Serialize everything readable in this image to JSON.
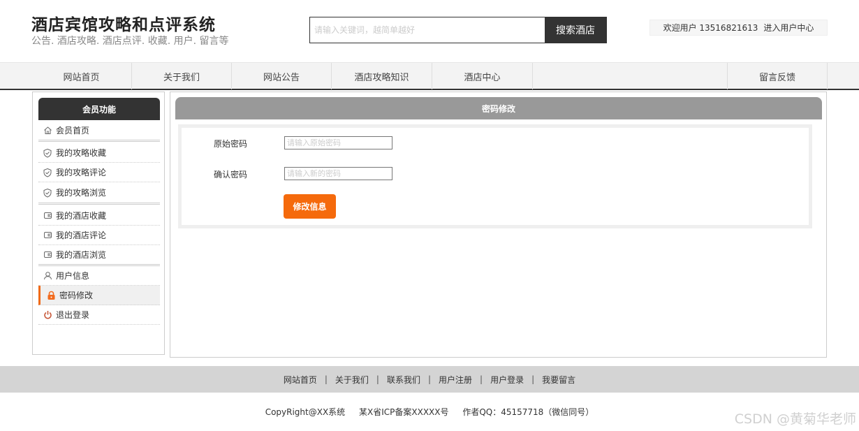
{
  "header": {
    "title": "酒店宾馆攻略和点评系统",
    "subtitle": "公告. 酒店攻略. 酒店点评. 收藏. 用户. 留言等",
    "search_placeholder": "请输入关键词，越简单越好",
    "search_button": "搜索酒店",
    "welcome_text": "欢迎用户 13516821613",
    "user_center_link": "进入用户中心"
  },
  "nav": {
    "items": [
      "网站首页",
      "关于我们",
      "网站公告",
      "酒店攻略知识",
      "酒店中心",
      "留言反馈"
    ]
  },
  "sidebar": {
    "title": "会员功能",
    "items": [
      {
        "label": "会员首页",
        "icon": "home-icon"
      },
      {
        "label": "我的攻略收藏",
        "icon": "shield-icon"
      },
      {
        "label": "我的攻略评论",
        "icon": "shield-icon"
      },
      {
        "label": "我的攻略浏览",
        "icon": "shield-icon"
      },
      {
        "label": "我的酒店收藏",
        "icon": "wallet-icon"
      },
      {
        "label": "我的酒店评论",
        "icon": "wallet-icon"
      },
      {
        "label": "我的酒店浏览",
        "icon": "wallet-icon"
      },
      {
        "label": "用户信息",
        "icon": "user-icon"
      },
      {
        "label": "密码修改",
        "icon": "lock-icon"
      },
      {
        "label": "退出登录",
        "icon": "power-icon"
      }
    ]
  },
  "main": {
    "title": "密码修改",
    "fields": [
      {
        "label": "原始密码",
        "placeholder": "请输入原始密码"
      },
      {
        "label": "确认密码",
        "placeholder": "请输入新的密码"
      }
    ],
    "submit_label": "修改信息"
  },
  "footer": {
    "links": [
      "网站首页",
      "关于我们",
      "联系我们",
      "用户注册",
      "用户登录",
      "我要留言"
    ],
    "separator": "|",
    "copyright": "CopyRight@XX系统",
    "icp": "某X省ICP备案XXXXX号",
    "author": "作者QQ：45157718（微信同号）",
    "watermark": "CSDN @黄菊华老师"
  },
  "colors": {
    "accent": "#f56a0c",
    "dark": "#333333",
    "panel_header": "#999999"
  }
}
